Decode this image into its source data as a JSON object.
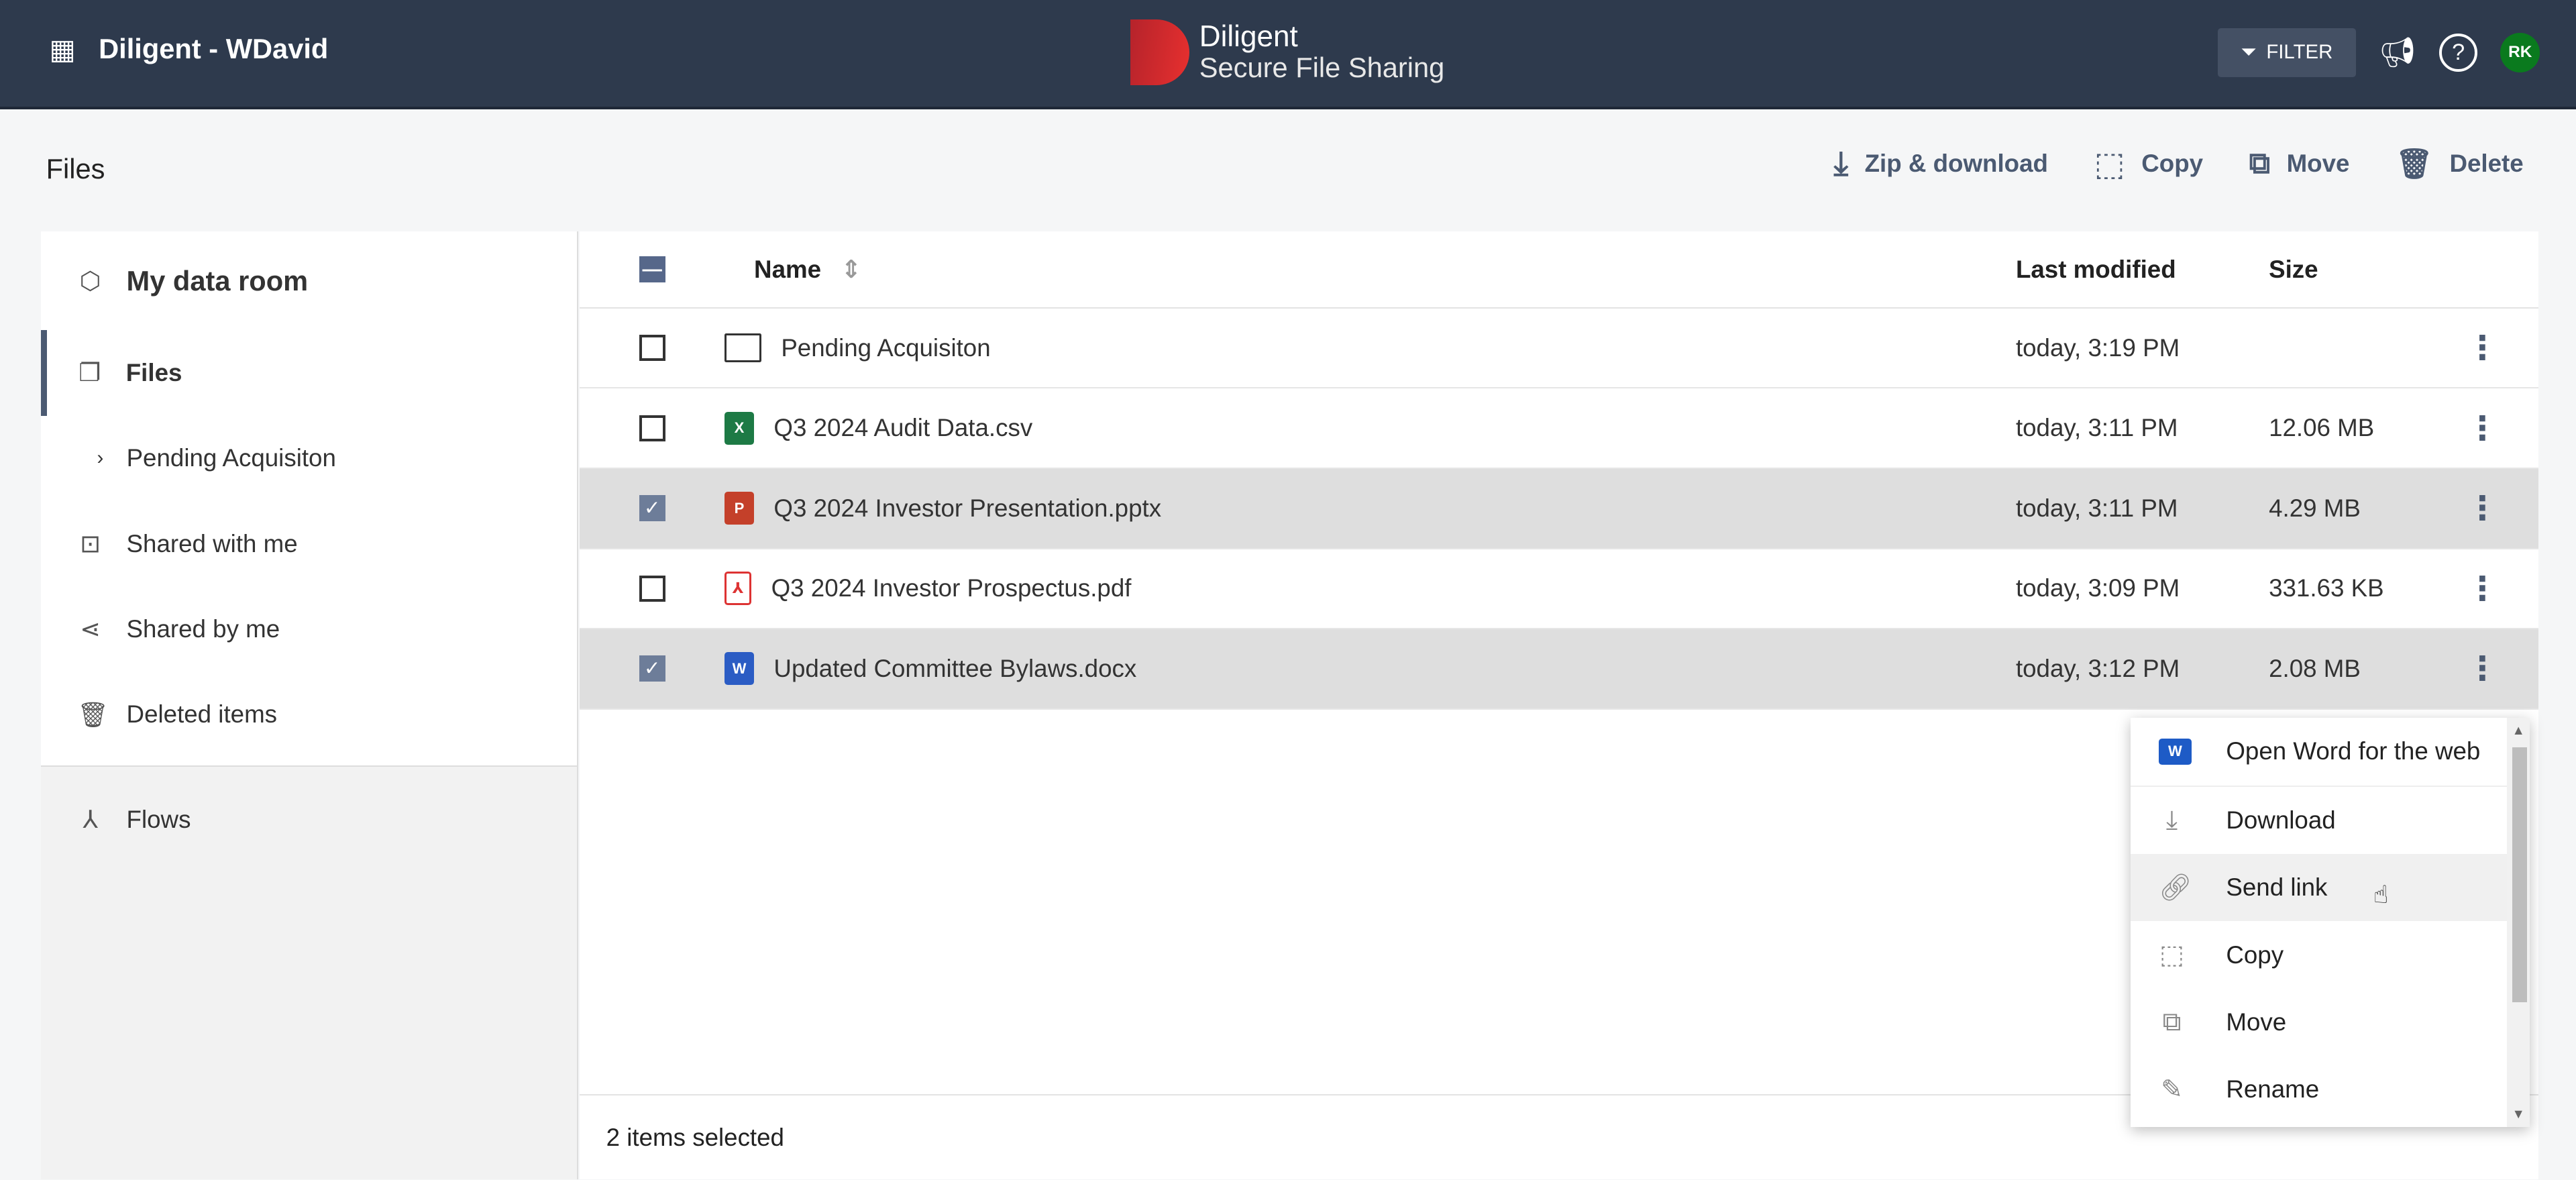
{
  "header": {
    "org_name": "Diligent - WDavid",
    "logo_line1": "Diligent",
    "logo_line2": "Secure File Sharing",
    "filter_label": "FILTER",
    "avatar_initials": "RK"
  },
  "page": {
    "title": "Files"
  },
  "actions": {
    "zip": "Zip & download",
    "copy": "Copy",
    "move": "Move",
    "delete": "Delete"
  },
  "sidebar": {
    "room": "My data room",
    "items": [
      {
        "label": "Files"
      },
      {
        "label": "Pending Acquisiton"
      },
      {
        "label": "Shared with me"
      },
      {
        "label": "Shared by me"
      },
      {
        "label": "Deleted items"
      }
    ],
    "flows": "Flows"
  },
  "table": {
    "headers": {
      "name": "Name",
      "modified": "Last modified",
      "size": "Size"
    },
    "rows": [
      {
        "name": "Pending Acquisiton",
        "modified": "today, 3:19 PM",
        "size": "",
        "type": "folder",
        "checked": false
      },
      {
        "name": "Q3 2024 Audit Data.csv",
        "modified": "today, 3:11 PM",
        "size": "12.06 MB",
        "type": "excel",
        "checked": false
      },
      {
        "name": "Q3 2024 Investor Presentation.pptx",
        "modified": "today, 3:11 PM",
        "size": "4.29 MB",
        "type": "powerpoint",
        "checked": true
      },
      {
        "name": "Q3 2024 Investor Prospectus.pdf",
        "modified": "today, 3:09 PM",
        "size": "331.63 KB",
        "type": "pdf",
        "checked": false
      },
      {
        "name": "Updated Committee Bylaws.docx",
        "modified": "today, 3:12 PM",
        "size": "2.08 MB",
        "type": "word",
        "checked": true
      }
    ]
  },
  "footer": {
    "status": "2 items selected"
  },
  "context_menu": {
    "items": [
      {
        "label": "Open Word for the web"
      },
      {
        "label": "Download"
      },
      {
        "label": "Send link"
      },
      {
        "label": "Copy"
      },
      {
        "label": "Move"
      },
      {
        "label": "Rename"
      }
    ]
  }
}
